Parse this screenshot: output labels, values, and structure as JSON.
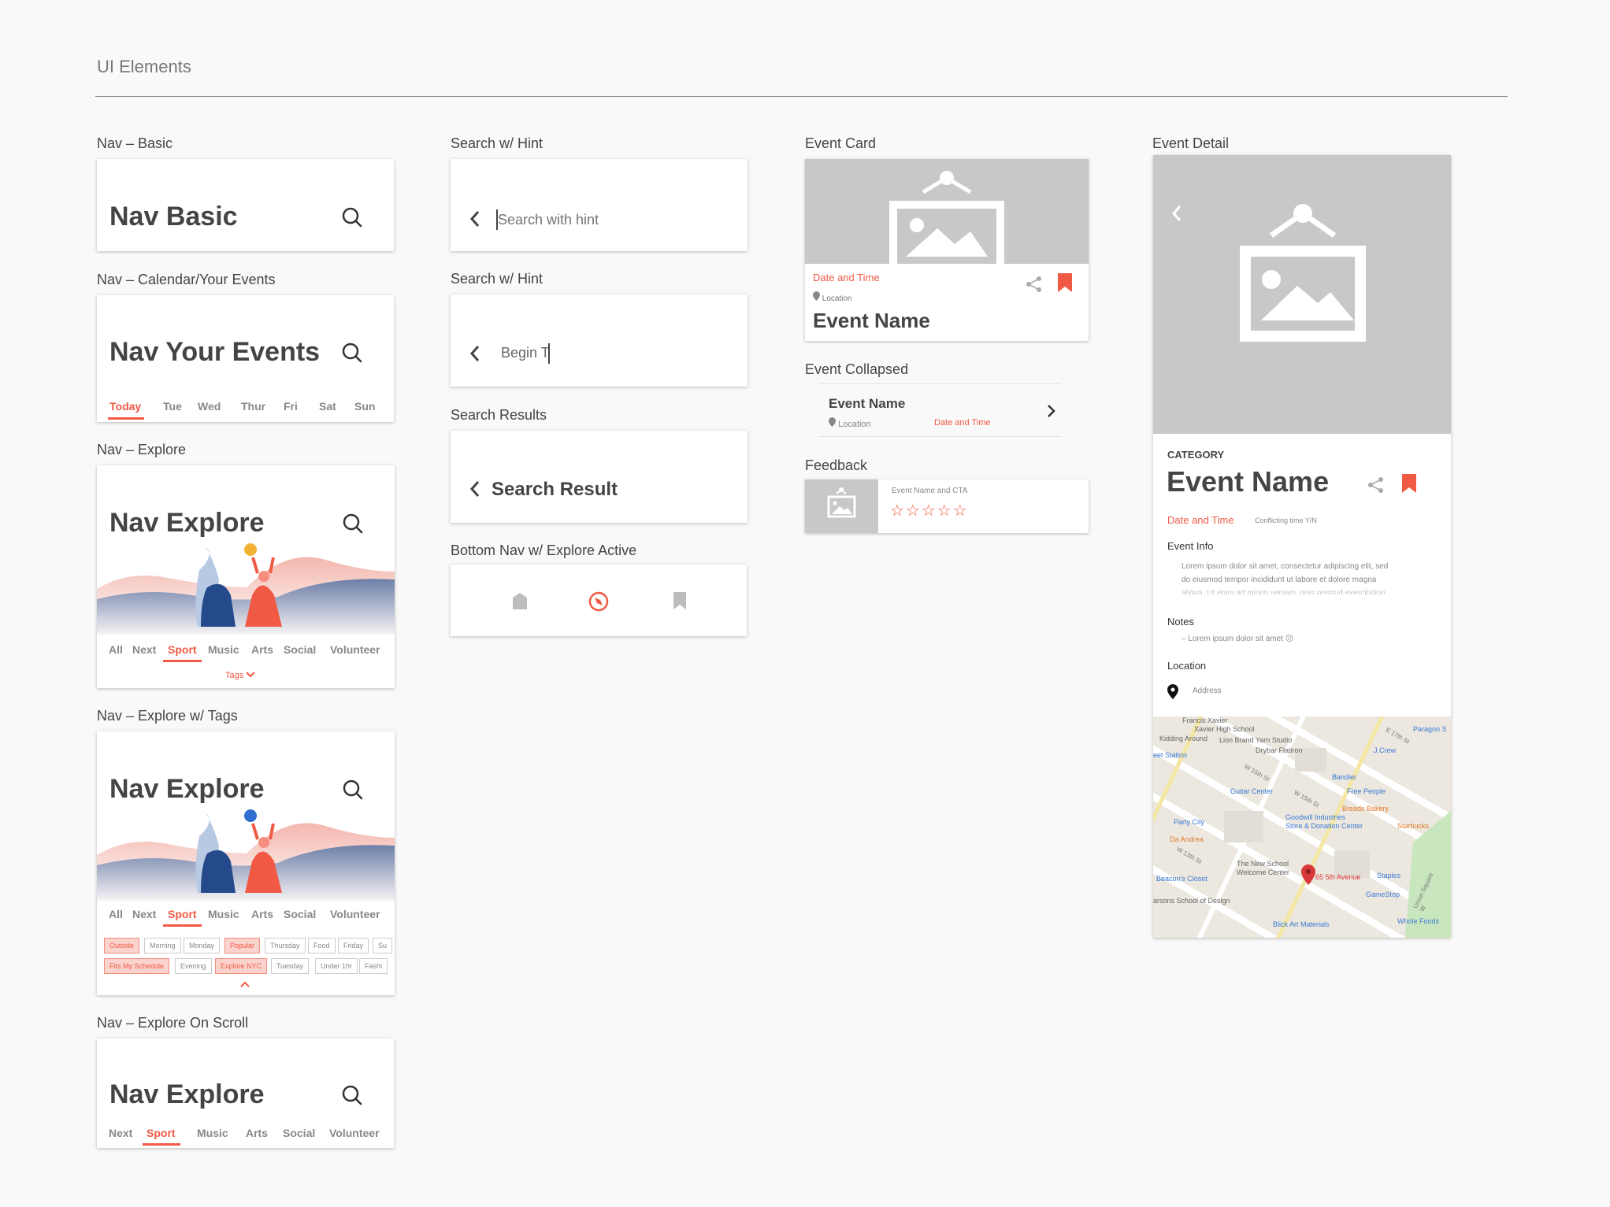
{
  "page": {
    "title": "UI Elements"
  },
  "colors": {
    "accent": "#f05a44",
    "placeholder_grey": "#c8c8c9",
    "navy": "#244a8c"
  },
  "labels": {
    "nav_basic": "Nav – Basic",
    "nav_calendar": "Nav – Calendar/Your Events",
    "nav_explore": "Nav – Explore",
    "nav_explore_tags": "Nav – Explore w/ Tags",
    "nav_explore_scroll": "Nav – Explore On Scroll",
    "search_hint_1": "Search w/ Hint",
    "search_hint_2": "Search w/ Hint",
    "search_results": "Search Results",
    "bottom_nav": "Bottom Nav w/ Explore Active",
    "event_card": "Event Card",
    "event_collapsed": "Event Collapsed",
    "feedback": "Feedback",
    "event_detail": "Event Detail"
  },
  "nav_basic": {
    "title": "Nav Basic"
  },
  "nav_calendar": {
    "title": "Nav Your Events",
    "days": [
      "Today",
      "Tue",
      "Wed",
      "Thur",
      "Fri",
      "Sat",
      "Sun"
    ]
  },
  "nav_explore": {
    "title": "Nav Explore",
    "tabs": [
      "All",
      "Next",
      "Sport",
      "Music",
      "Arts",
      "Social",
      "Volunteer"
    ],
    "tags_label": "Tags"
  },
  "nav_explore_tags": {
    "title": "Nav Explore",
    "tabs": [
      "All",
      "Next",
      "Sport",
      "Music",
      "Arts",
      "Social",
      "Volunteer"
    ],
    "row1": [
      "Outside",
      "Morning",
      "Monday",
      "Popular",
      "Thursday",
      "Food",
      "Friday",
      "Su"
    ],
    "row2": [
      "Fits My Schedule",
      "Evening",
      "Explore NYC",
      "Tuesday",
      "Under 1hr",
      "Fashi"
    ]
  },
  "nav_explore_scroll": {
    "title": "Nav Explore",
    "tabs": [
      "Next",
      "Sport",
      "Music",
      "Arts",
      "Social",
      "Volunteer"
    ]
  },
  "search1": {
    "placeholder": "Search with hint"
  },
  "search2": {
    "value": "Begin T"
  },
  "search_result": {
    "title": "Search Result"
  },
  "event_card": {
    "date": "Date and Time",
    "location": "Location",
    "name": "Event Name"
  },
  "event_collapsed": {
    "name": "Event Name",
    "location": "Location",
    "date": "Date and Time"
  },
  "feedback": {
    "text": "Event Name and CTA",
    "stars": "☆☆☆☆☆"
  },
  "event_detail": {
    "category": "CATEGORY",
    "name": "Event Name",
    "date": "Date and Time",
    "conflict": "Conflicting time Y/N",
    "info_heading": "Event Info",
    "info_lines": [
      "Lorem ipsum dolor sit amet, consectetur adipiscing elit, sed",
      "do eiusmod tempor incididunt ut labore et dolore magna",
      "aliqua. Ut enim ad minim veniam, quis nostrud exercitation"
    ],
    "notes_heading": "Notes",
    "note": "– Lorem ipsum dolor sit amet 😕",
    "location_heading": "Location",
    "address": "Address",
    "map_labels": [
      "Francis Xavier",
      "Xavier High School",
      "Kidding Around",
      "Lion Brand Yarn Studio",
      "Drybar Flatiron",
      "J.Crew",
      "Paragon S",
      "eet Station",
      "W 15th St",
      "Bandier",
      "Guitar Center",
      "W 15th St",
      "Free People",
      "Breads Bakery",
      "Party City",
      "Goodwill Industries",
      "Store & Donation Center",
      "Starbucks",
      "Da Andrea",
      "W 13th St",
      "The New School",
      "Welcome Center",
      "65 5th Avenue",
      "Staples",
      "Beacon's Closet",
      "GameStop",
      "arsons School of Design",
      "Blick Art Materials",
      "Whole Foods",
      "E 17th St",
      "Union Square W"
    ]
  }
}
